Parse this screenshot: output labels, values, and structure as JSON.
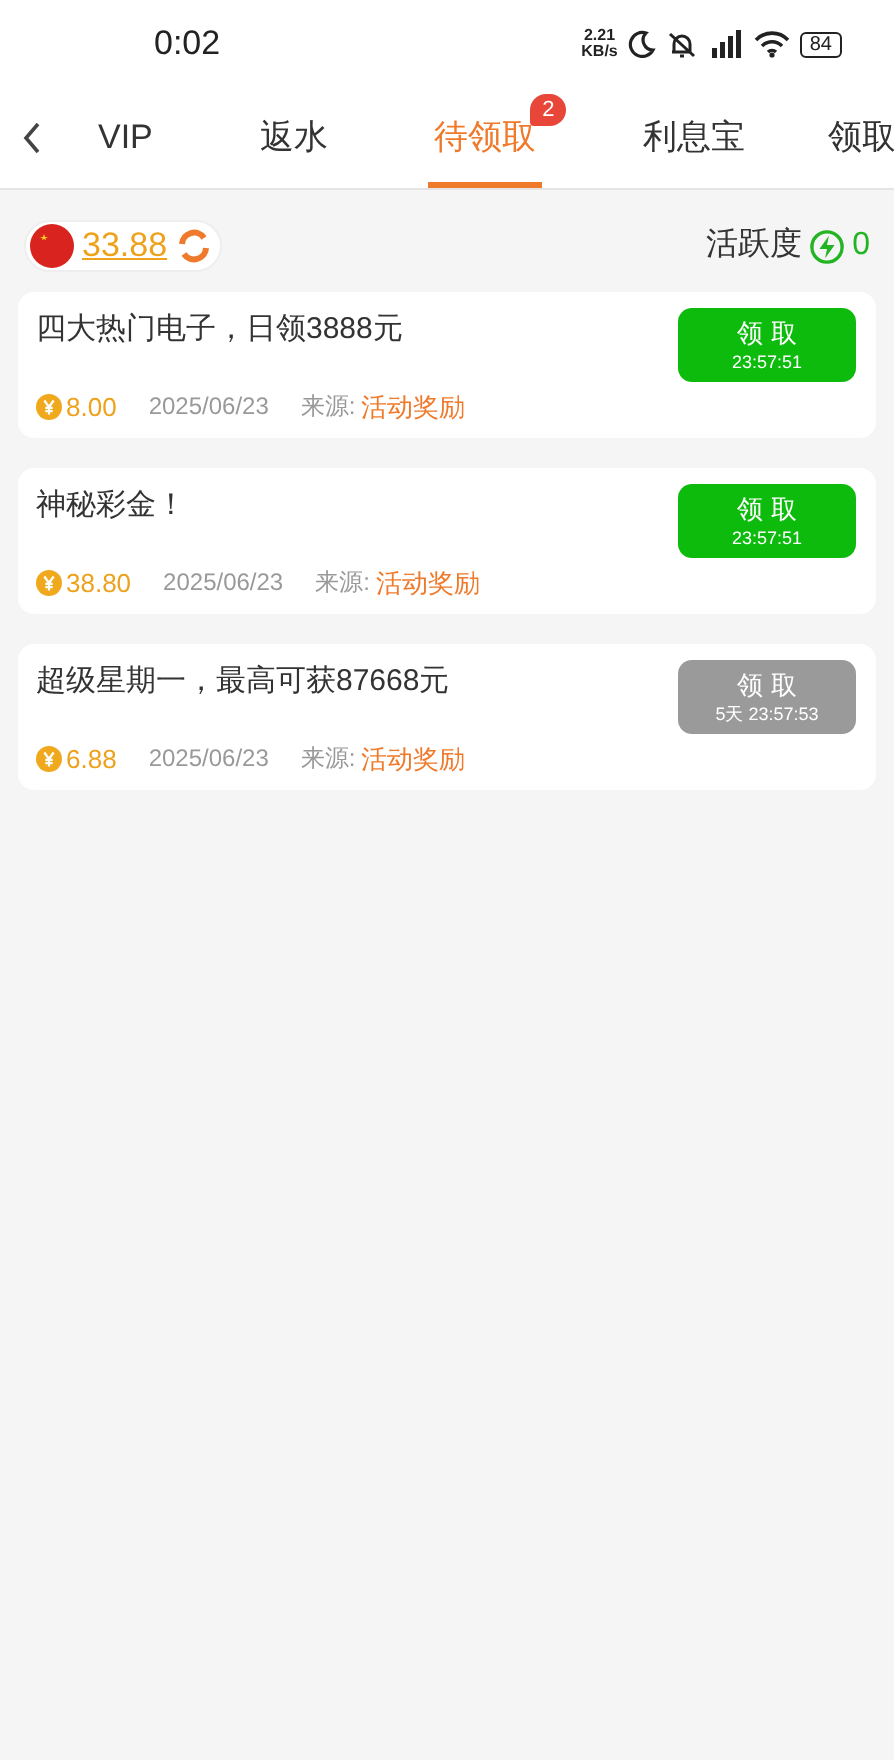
{
  "status_bar": {
    "time": "0:02",
    "net_speed": "2.21",
    "net_unit": "KB/s",
    "battery": "84"
  },
  "tabs": [
    {
      "label": "VIP",
      "selected": false
    },
    {
      "label": "返水",
      "selected": false
    },
    {
      "label": "待领取",
      "selected": true,
      "badge": "2"
    },
    {
      "label": "利息宝",
      "selected": false
    },
    {
      "label": "领取",
      "selected": false
    }
  ],
  "balance": {
    "amount": "33.88",
    "activity_label": "活跃度",
    "activity_value": "0"
  },
  "rewards": [
    {
      "title": "四大热门电子，日领3888元",
      "amount": "8.00",
      "date": "2025/06/23",
      "source_label": "来源:",
      "source": "活动奖励",
      "button": "领 取",
      "countdown": "23:57:51",
      "disabled": false
    },
    {
      "title": "神秘彩金！",
      "amount": "38.80",
      "date": "2025/06/23",
      "source_label": "来源:",
      "source": "活动奖励",
      "button": "领 取",
      "countdown": "23:57:51",
      "disabled": false
    },
    {
      "title": "超级星期一，最高可获87668元",
      "amount": "6.88",
      "date": "2025/06/23",
      "source_label": "来源:",
      "source": "活动奖励",
      "button": "领 取",
      "countdown": "5天 23:57:53",
      "disabled": true
    }
  ]
}
